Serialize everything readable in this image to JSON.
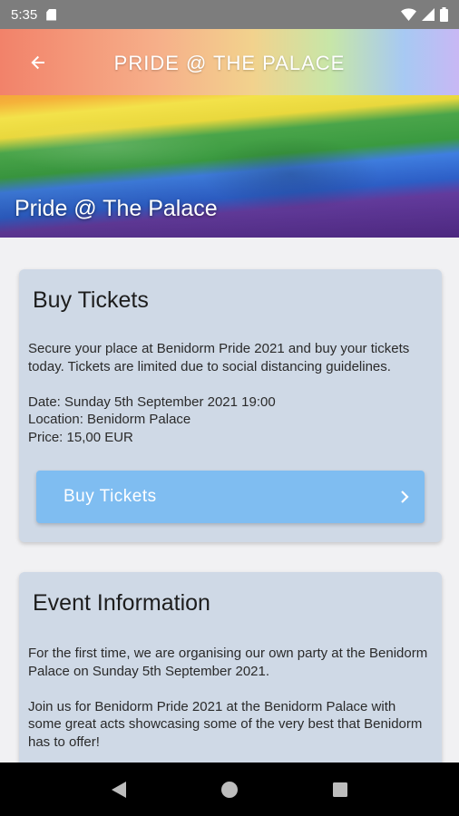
{
  "status_bar": {
    "time": "5:35",
    "icons": [
      "sd-card-icon",
      "wifi-icon",
      "signal-icon",
      "battery-icon"
    ]
  },
  "app_bar": {
    "title": "PRIDE @ THE PALACE",
    "back_icon": "arrow-left-icon",
    "gradient_colors": [
      "#f2826a",
      "#f6b08a",
      "#f2d28d",
      "#c7e6a8",
      "#a7c9f3",
      "#c8b8f4"
    ]
  },
  "hero": {
    "title": "Pride @ The Palace"
  },
  "tickets_card": {
    "title": "Buy Tickets",
    "description": "Secure your place at Benidorm Pride 2021 and buy your tickets today. Tickets are limited due to social distancing guidelines.",
    "date": "Date: Sunday 5th September 2021 19:00",
    "location": "Location: Benidorm Palace",
    "price": "Price: 15,00 EUR",
    "button_label": "Buy Tickets",
    "button_icon": "chevron-right-icon",
    "button_color": "#7fbdf1"
  },
  "event_card": {
    "title": "Event Information",
    "paragraph1": "For the first time, we are organising our own party at the Benidorm Palace on Sunday 5th September 2021.",
    "paragraph2": "Join us for Benidorm Pride 2021 at the Benidorm Palace with some great acts showcasing some of the very best that Benidorm has to offer!"
  },
  "nav_bar": {
    "buttons": [
      "back-triangle-icon",
      "home-circle-icon",
      "recents-square-icon"
    ]
  },
  "colors": {
    "card_background": "#cfd9e6",
    "page_background": "#f1f1f3"
  }
}
